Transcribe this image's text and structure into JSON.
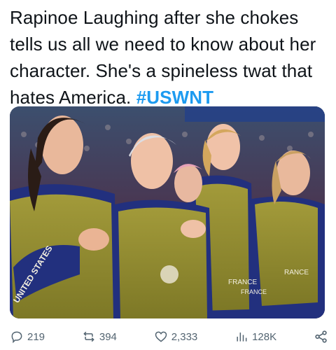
{
  "tweet": {
    "text": "Rapinoe Laughing after she chokes tells us all we need to know about her character. She's a spineless twat that hates America.",
    "hashtag": "#USWNT"
  },
  "media": {
    "jersey_texts": [
      "UNITED STATES",
      "FRANCE",
      "FRANCE",
      "FRANCE"
    ],
    "colors": {
      "pinnie": "#8f8a2c",
      "jersey": "#1f2f7a",
      "crowd": "#3a2a44"
    }
  },
  "actions": {
    "replies": "219",
    "retweets": "394",
    "likes": "2,333",
    "views": "128K"
  },
  "icons": [
    "reply-icon",
    "retweet-icon",
    "like-icon",
    "views-icon",
    "share-icon"
  ]
}
